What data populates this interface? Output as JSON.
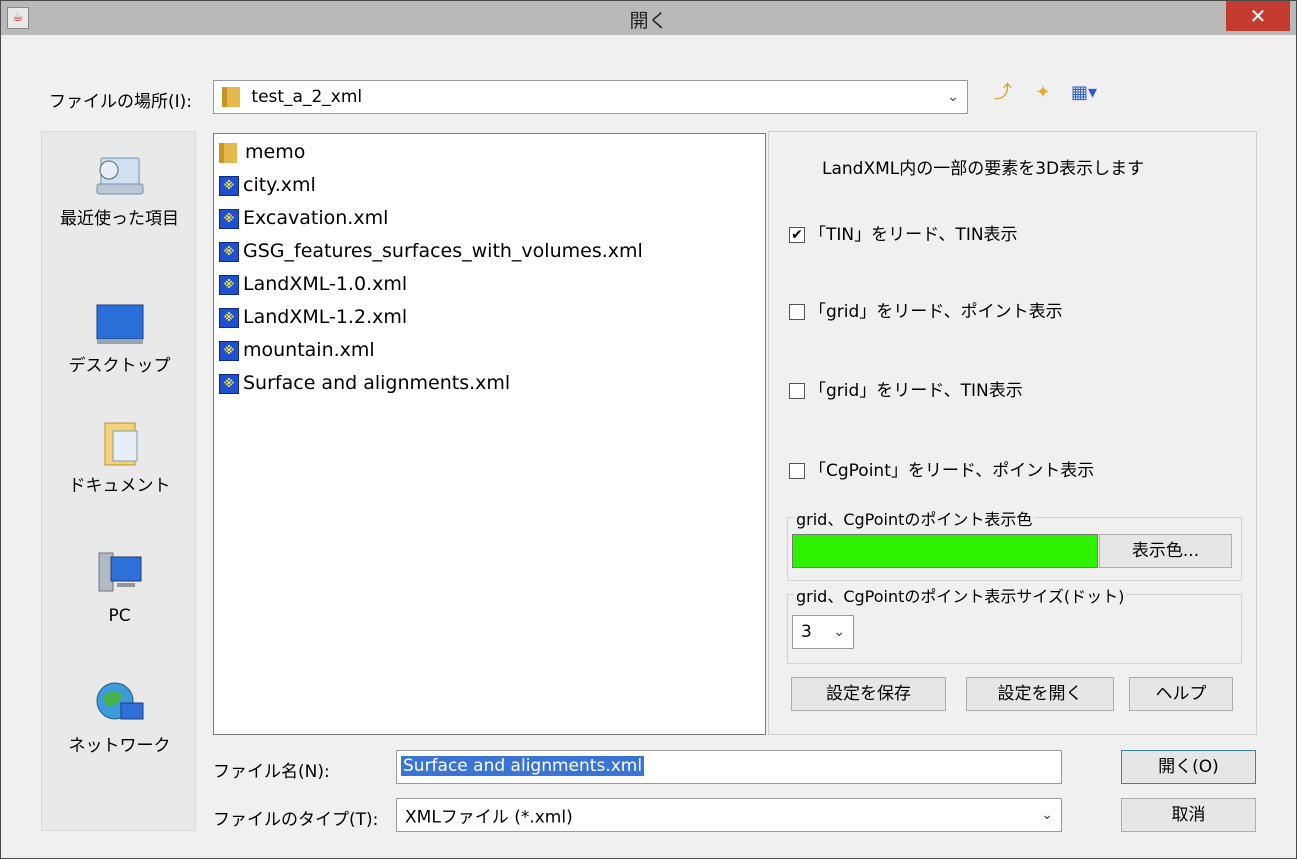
{
  "window": {
    "title": "開く",
    "close_glyph": "✕"
  },
  "lookin": {
    "label": "ファイルの場所(I):",
    "value": "test_a_2_xml"
  },
  "places": [
    {
      "label": "最近使った項目",
      "icon": "recent-items-icon"
    },
    {
      "label": "デスクトップ",
      "icon": "desktop-icon"
    },
    {
      "label": "ドキュメント",
      "icon": "documents-icon"
    },
    {
      "label": "PC",
      "icon": "pc-icon"
    },
    {
      "label": "ネットワーク",
      "icon": "network-icon"
    }
  ],
  "files": [
    {
      "name": "memo",
      "type": "folder"
    },
    {
      "name": "city.xml",
      "type": "xml"
    },
    {
      "name": "Excavation.xml",
      "type": "xml"
    },
    {
      "name": "GSG_features_surfaces_with_volumes.xml",
      "type": "xml"
    },
    {
      "name": "LandXML-1.0.xml",
      "type": "xml"
    },
    {
      "name": "LandXML-1.2.xml",
      "type": "xml"
    },
    {
      "name": "mountain.xml",
      "type": "xml"
    },
    {
      "name": "Surface and alignments.xml",
      "type": "xml"
    }
  ],
  "panel": {
    "heading": "LandXML内の一部の要素を3D表示します",
    "options": [
      {
        "label": "「TIN」をリード、TIN表示",
        "checked": true
      },
      {
        "label": "「grid」をリード、ポイント表示",
        "checked": false
      },
      {
        "label": "「grid」をリード、TIN表示",
        "checked": false
      },
      {
        "label": "「CgPoint」をリード、ポイント表示",
        "checked": false
      }
    ],
    "color_group": {
      "title": "grid、CgPointのポイント表示色",
      "color": "#2ef200",
      "button": "表示色..."
    },
    "size_group": {
      "title": "grid、CgPointのポイント表示サイズ(ドット)",
      "value": "3"
    },
    "buttons": {
      "save": "設定を保存",
      "open": "設定を開く",
      "help": "ヘルプ"
    }
  },
  "filename": {
    "label": "ファイル名(N):",
    "value": "Surface and alignments.xml"
  },
  "filetype": {
    "label": "ファイルのタイプ(T):",
    "value": "XMLファイル (*.xml)"
  },
  "actions": {
    "open": "開く(O)",
    "cancel": "取消"
  }
}
